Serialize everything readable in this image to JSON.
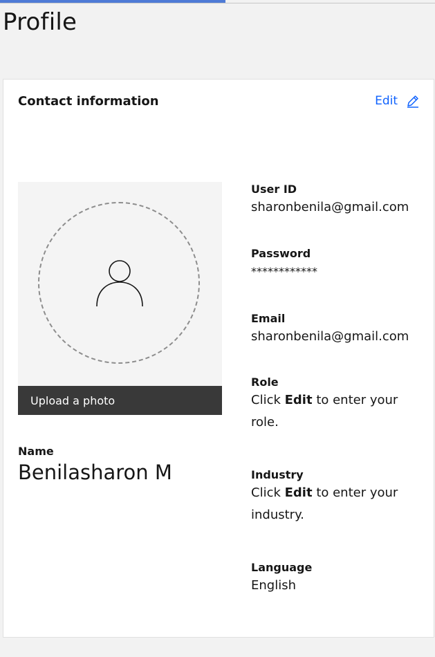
{
  "page": {
    "title": "Profile",
    "progress_fraction": 0.52
  },
  "card": {
    "title": "Contact information",
    "edit_label": "Edit"
  },
  "photo": {
    "upload_label": "Upload a photo"
  },
  "name": {
    "label": "Name",
    "value": "Benilasharon M"
  },
  "fields": {
    "user_id": {
      "label": "User ID",
      "value": "sharonbenila@gmail.com"
    },
    "password": {
      "label": "Password",
      "value": "************"
    },
    "email": {
      "label": "Email",
      "value": "sharonbenila@gmail.com"
    },
    "role": {
      "label": "Role",
      "hint_prefix": "Click ",
      "hint_bold": "Edit",
      "hint_suffix": " to enter your role."
    },
    "industry": {
      "label": "Industry",
      "hint_prefix": "Click ",
      "hint_bold": "Edit",
      "hint_suffix": " to enter your industry."
    },
    "language": {
      "label": "Language",
      "value": "English"
    }
  },
  "icons": {
    "edit": "pencil-icon",
    "avatar": "user-silhouette-icon"
  },
  "colors": {
    "accent": "#0f62fe",
    "progress": "#4f7bd6",
    "upload_bar": "#393939"
  }
}
